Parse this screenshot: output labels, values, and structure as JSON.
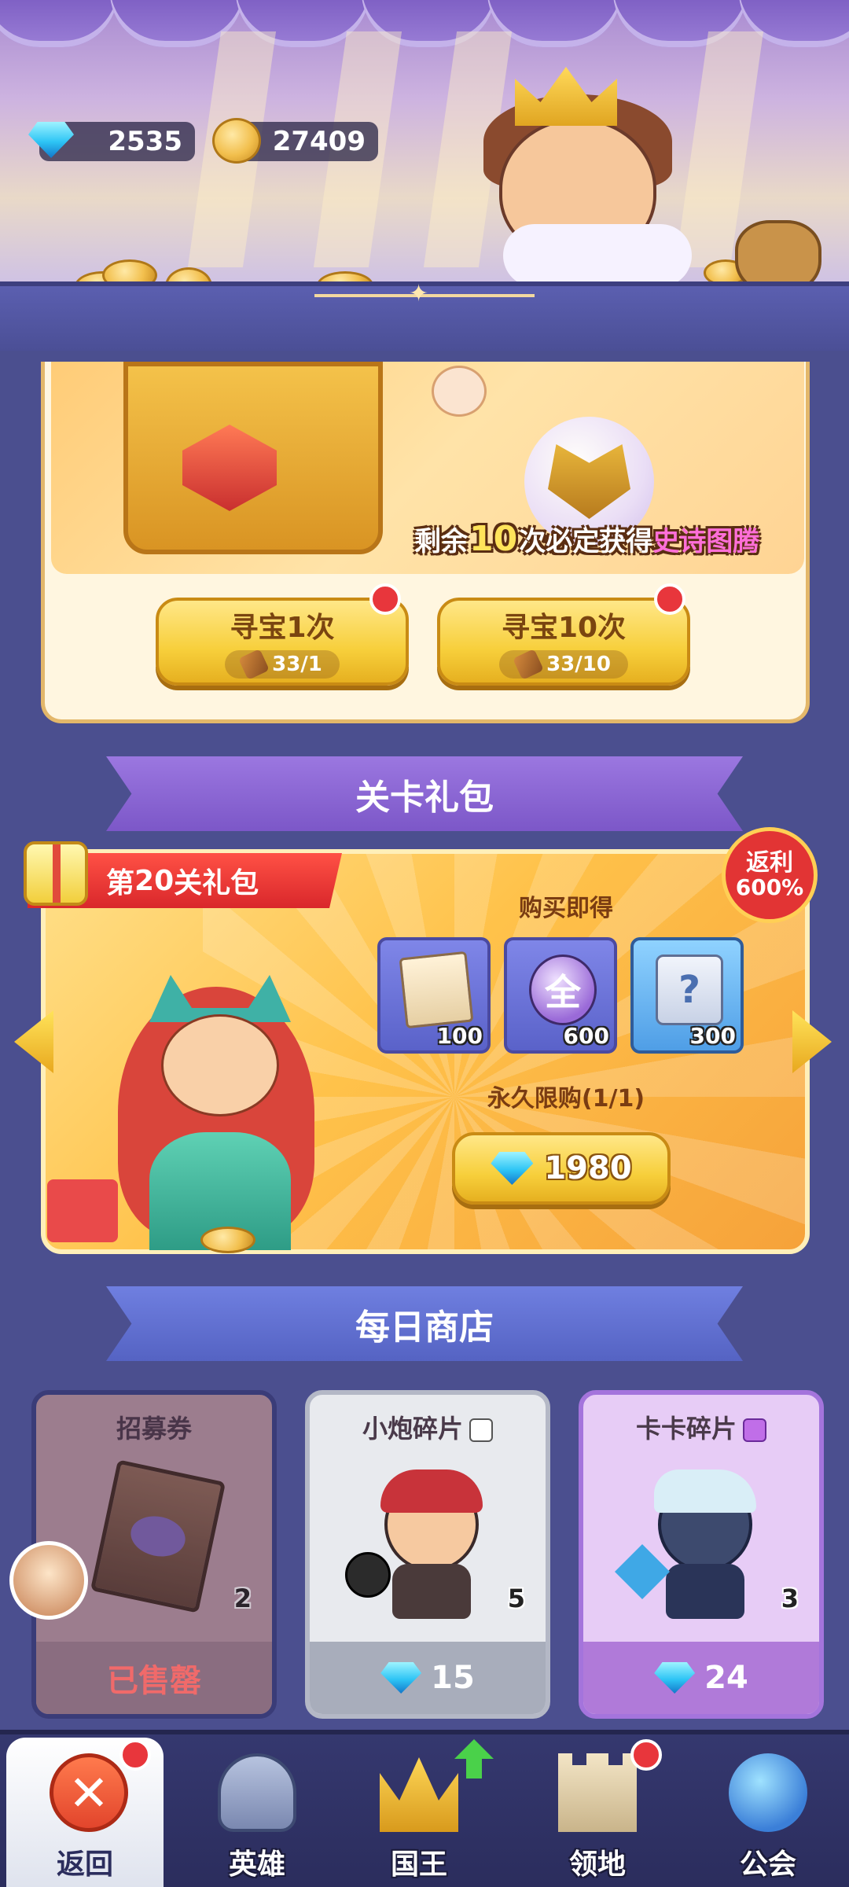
{
  "currency": {
    "gems": "2535",
    "coins": "27409",
    "gem_icon": "diamond-icon",
    "coin_icon": "gold-coin-icon"
  },
  "treasure": {
    "guarantee_prefix": "剩余",
    "guarantee_count": "10",
    "guarantee_mid": "次必定获得",
    "guarantee_item": "史诗图腾",
    "btn_single_label": "寻宝1次",
    "btn_single_cost": "33/1",
    "btn_ten_label": "寻宝10次",
    "btn_ten_cost": "33/10"
  },
  "stage_pack": {
    "section_title": "关卡礼包",
    "pack_prefix": "第",
    "pack_stage": "20",
    "pack_suffix": "关礼包",
    "rebate_label": "返利",
    "rebate_value": "600%",
    "buy_label": "购买即得",
    "items": [
      {
        "icon": "recruit-ticket-icon",
        "qty": "100"
      },
      {
        "icon": "all-orb-icon",
        "glyph": "全",
        "qty": "600"
      },
      {
        "icon": "mystery-scroll-icon",
        "glyph": "?",
        "qty": "300"
      }
    ],
    "limit_label": "永久限购(1/1)",
    "price": "1980"
  },
  "daily_shop": {
    "section_title": "每日商店",
    "cards": [
      {
        "name": "招募券",
        "count": "2",
        "status": "已售罄"
      },
      {
        "name": "小炮碎片",
        "count": "5",
        "price": "15"
      },
      {
        "name": "卡卡碎片",
        "count": "3",
        "price": "24"
      }
    ]
  },
  "nav": {
    "back": "返回",
    "heroes": "英雄",
    "king": "国王",
    "territory": "领地",
    "guild": "公会"
  },
  "colors": {
    "accent_purple": "#7c57c8",
    "gold": "#f7cf3b",
    "alert_red": "#e8363c",
    "nav_bg": "#2b2d5d"
  }
}
